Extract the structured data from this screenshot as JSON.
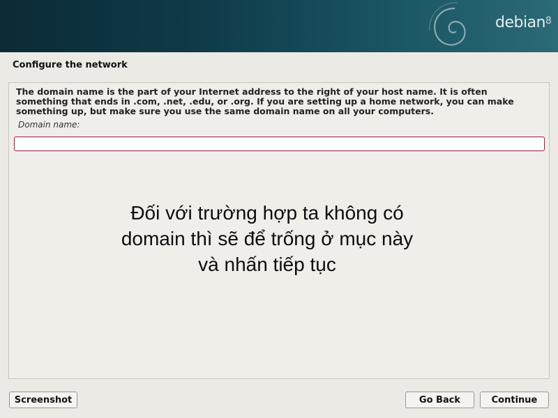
{
  "header": {
    "brand": "debian",
    "version": "8",
    "logo_icon": "debian-swirl-icon"
  },
  "page": {
    "title": "Configure the network"
  },
  "panel": {
    "description": "The domain name is the part of your Internet address to the right of your host name.  It is often\nsomething that ends in .com, .net, .edu, or .org.  If you are setting up a home network, you can make\nsomething up, but make sure you use the same domain name on all your computers.",
    "field_label": "Domain name:",
    "field_value": ""
  },
  "annotation": {
    "text": "Đối với trường hợp ta không có\ndomain thì sẽ để trống ở mục này\nvà nhấn tiếp tục"
  },
  "footer": {
    "screenshot_label": "Screenshot",
    "back_label": "Go Back",
    "continue_label": "Continue"
  },
  "colors": {
    "banner": "#0f3a48",
    "input_border": "#8e1f46",
    "background": "#eceae5"
  }
}
